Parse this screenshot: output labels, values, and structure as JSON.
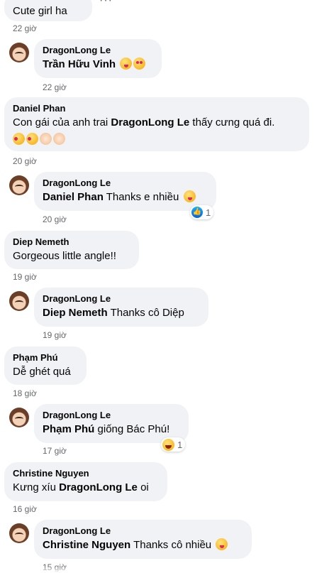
{
  "comments": [
    {
      "text": "Cute girl ha",
      "time": "22 giờ"
    },
    {
      "author": "DragonLong Le",
      "tag": "Trần Hữu Vinh",
      "text": "",
      "time": "22 giờ"
    },
    {
      "author": "Daniel Phan",
      "text_before": "Con gái của anh trai ",
      "tag": "DragonLong Le",
      "text_after": " thấy cưng quá đi.",
      "time": "20 giờ"
    },
    {
      "author": "DragonLong Le",
      "tag": "Daniel Phan",
      "text": " Thanks e nhiều",
      "time": "20 giờ",
      "reaction_count": "1"
    },
    {
      "author": "Diep Nemeth",
      "text": "Gorgeous little angle!!",
      "time": "19 giờ"
    },
    {
      "author": "DragonLong Le",
      "tag": "Diep Nemeth",
      "text": " Thanks cô Diệp",
      "time": "19 giờ"
    },
    {
      "author": "Phạm Phú",
      "text": "Dễ ghét quá",
      "time": "18 giờ"
    },
    {
      "author": "DragonLong Le",
      "tag": "Phạm Phú",
      "text": " giống Bác Phú!",
      "time": "17 giờ",
      "reaction_count": "1"
    },
    {
      "author": "Christine Nguyen",
      "text_before": "Kưng xíu ",
      "tag": "DragonLong Le",
      "text_after": " oi",
      "time": "16 giờ"
    },
    {
      "author": "DragonLong Le",
      "tag": "Christine Nguyen",
      "text": " Thanks cô nhiều",
      "time": "15 giờ"
    }
  ],
  "ui": {
    "more_dots": "···"
  },
  "icons": {
    "like": "like-icon",
    "emoji": "emoji-icon",
    "avatar": "avatar-photo"
  },
  "colors": {
    "bubble": "#f0f2f5",
    "time": "#65676b",
    "like": "#1877f2"
  }
}
